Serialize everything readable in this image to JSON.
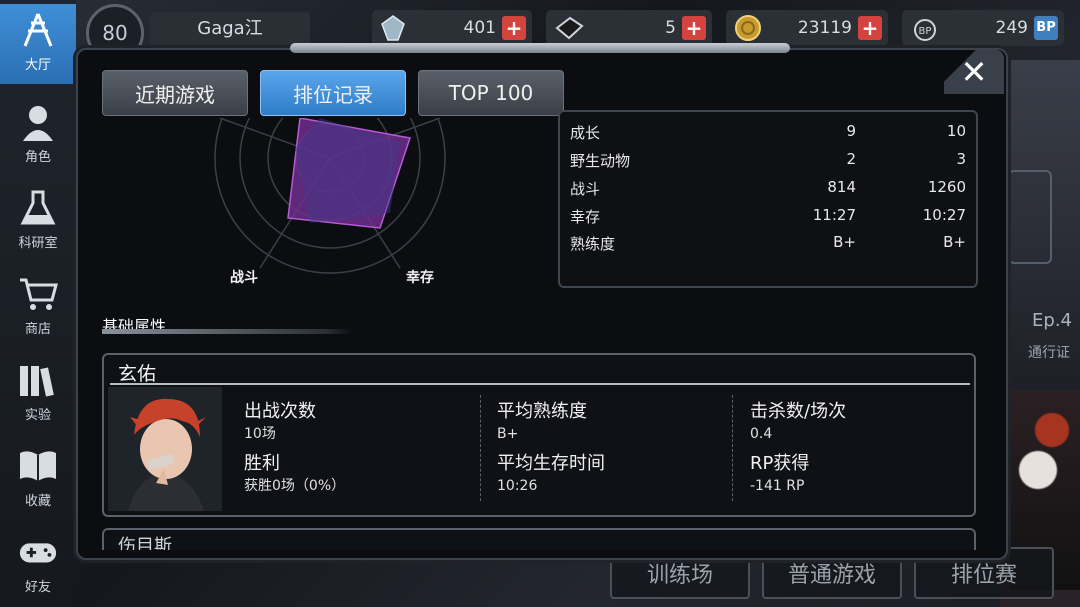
{
  "sidebar": {
    "items": [
      {
        "label": "大厅",
        "icon": "lobby-icon"
      },
      {
        "label": "角色",
        "icon": "character-icon"
      },
      {
        "label": "科研室",
        "icon": "flask-icon"
      },
      {
        "label": "商店",
        "icon": "cart-icon"
      },
      {
        "label": "实验",
        "icon": "books-icon"
      },
      {
        "label": "收藏",
        "icon": "book-icon"
      },
      {
        "label": "好友",
        "icon": "gamepad-icon"
      }
    ]
  },
  "topbar": {
    "level": "80",
    "username": "Gaga江",
    "resources": [
      {
        "icon": "crystal-icon",
        "value": "401",
        "plus": "+"
      },
      {
        "icon": "ticket-icon",
        "value": "5",
        "plus": "+"
      },
      {
        "icon": "coin-icon",
        "value": "23119",
        "plus": "+"
      },
      {
        "icon": "bp-icon",
        "value": "249",
        "plus": "BP"
      }
    ]
  },
  "modal": {
    "close": "✕",
    "tabs": [
      {
        "label": "近期游戏",
        "active": false
      },
      {
        "label": "排位记录",
        "active": true
      },
      {
        "label": "TOP 100",
        "active": false
      }
    ]
  },
  "radar": {
    "labels": {
      "bottom_left": "战斗",
      "bottom_right": "幸存"
    }
  },
  "stats": {
    "rows": [
      {
        "name": "成长",
        "v1": "9",
        "v2": "10"
      },
      {
        "name": "野生动物",
        "v1": "2",
        "v2": "3"
      },
      {
        "name": "战斗",
        "v1": "814",
        "v2": "1260"
      },
      {
        "name": "幸存",
        "v1": "11:27",
        "v2": "10:27"
      },
      {
        "name": "熟练度",
        "v1": "B+",
        "v2": "B+"
      }
    ]
  },
  "section": {
    "title": "基础属性"
  },
  "card": {
    "name": "玄佑",
    "col1": {
      "l1": "出战次数",
      "v1": "10场",
      "l2": "胜利",
      "v2": "获胜0场（0%）"
    },
    "col2": {
      "l1": "平均熟练度",
      "v1": "B+",
      "l2": "平均生存时间",
      "v2": "10:26"
    },
    "col3": {
      "l1": "击杀数/场次",
      "v1": "0.4",
      "l2": "RP获得",
      "v2": "-141 RP"
    }
  },
  "next_card": {
    "name": "伤目斯"
  },
  "background": {
    "ep": "Ep.4",
    "pass": "通行证",
    "buttons": [
      "训练场",
      "普通游戏",
      "排位赛"
    ]
  }
}
